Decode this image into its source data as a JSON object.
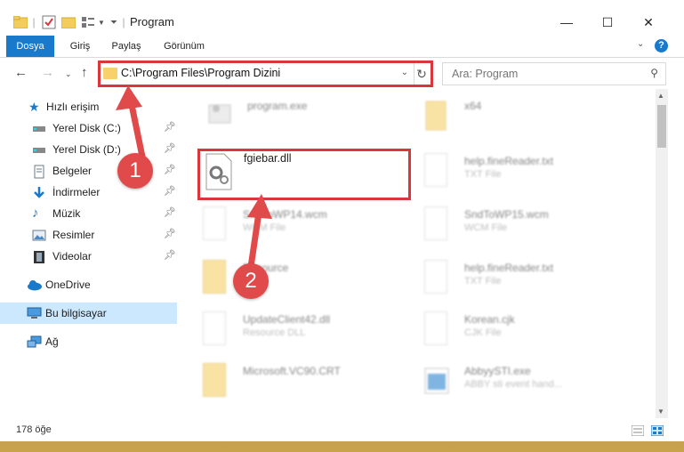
{
  "window": {
    "title": "Program",
    "controls": {
      "minimize": "—",
      "maximize": "☐",
      "close": "✕"
    }
  },
  "ribbon": {
    "tabs": [
      "Dosya",
      "Giriş",
      "Paylaş",
      "Görünüm"
    ],
    "active_tab": "Dosya",
    "help": "?"
  },
  "nav": {
    "path": "C:\\Program Files\\Program Dizini",
    "search_placeholder": "Ara: Program"
  },
  "sidebar": {
    "quick_access": "Hızlı erişim",
    "items": [
      {
        "label": "Yerel Disk (C:)",
        "icon": "drive-icon"
      },
      {
        "label": "Yerel Disk (D:)",
        "icon": "drive-icon"
      },
      {
        "label": "Belgeler",
        "icon": "documents-icon"
      },
      {
        "label": "İndirmeler",
        "icon": "download-icon"
      },
      {
        "label": "Müzik",
        "icon": "music-icon"
      },
      {
        "label": "Resimler",
        "icon": "pictures-icon"
      },
      {
        "label": "Videolar",
        "icon": "video-icon"
      }
    ],
    "onedrive": "OneDrive",
    "this_pc": "Bu bilgisayar",
    "network": "Ağ"
  },
  "files": [
    {
      "name": "program.exe",
      "type": "",
      "icon": "exe-icon",
      "highlighted": false
    },
    {
      "name": "x64",
      "type": "",
      "icon": "folder-icon",
      "highlighted": false
    },
    {
      "name": "fgiebar.dll",
      "type": "",
      "icon": "dll-gear-icon",
      "highlighted": true
    },
    {
      "name": "help.fineReader.txt",
      "type": "TXT File",
      "icon": "text-file-icon",
      "highlighted": false
    },
    {
      "name": "SndToWP14.wcm",
      "type": "WCM File",
      "icon": "blank-file-icon",
      "highlighted": false
    },
    {
      "name": "SndToWP15.wcm",
      "type": "WCM File",
      "icon": "blank-file-icon",
      "highlighted": false
    },
    {
      "name": "Resource",
      "type": "",
      "icon": "folder-icon",
      "highlighted": false
    },
    {
      "name": "help.fineReader.txt",
      "type": "TXT File",
      "icon": "text-file-icon",
      "highlighted": false
    },
    {
      "name": "UpdateClient42.dll",
      "type": "Resource DLL",
      "icon": "dll-gear-icon",
      "highlighted": false
    },
    {
      "name": "Korean.cjk",
      "type": "CJK File",
      "icon": "blank-file-icon",
      "highlighted": false
    },
    {
      "name": "Microsoft.VC90.CRT",
      "type": "",
      "icon": "folder-icon",
      "highlighted": false
    },
    {
      "name": "AbbyySTI.exe",
      "type": "ABBY sti event hand...",
      "icon": "exe-icon",
      "highlighted": false
    }
  ],
  "status": {
    "item_count": "178 öğe"
  },
  "annotations": {
    "step1": "1",
    "step2": "2"
  },
  "colors": {
    "accent": "#1979ca",
    "highlight_box": "#d9363e",
    "badge": "#e04a4a",
    "selection": "#cce8ff"
  }
}
